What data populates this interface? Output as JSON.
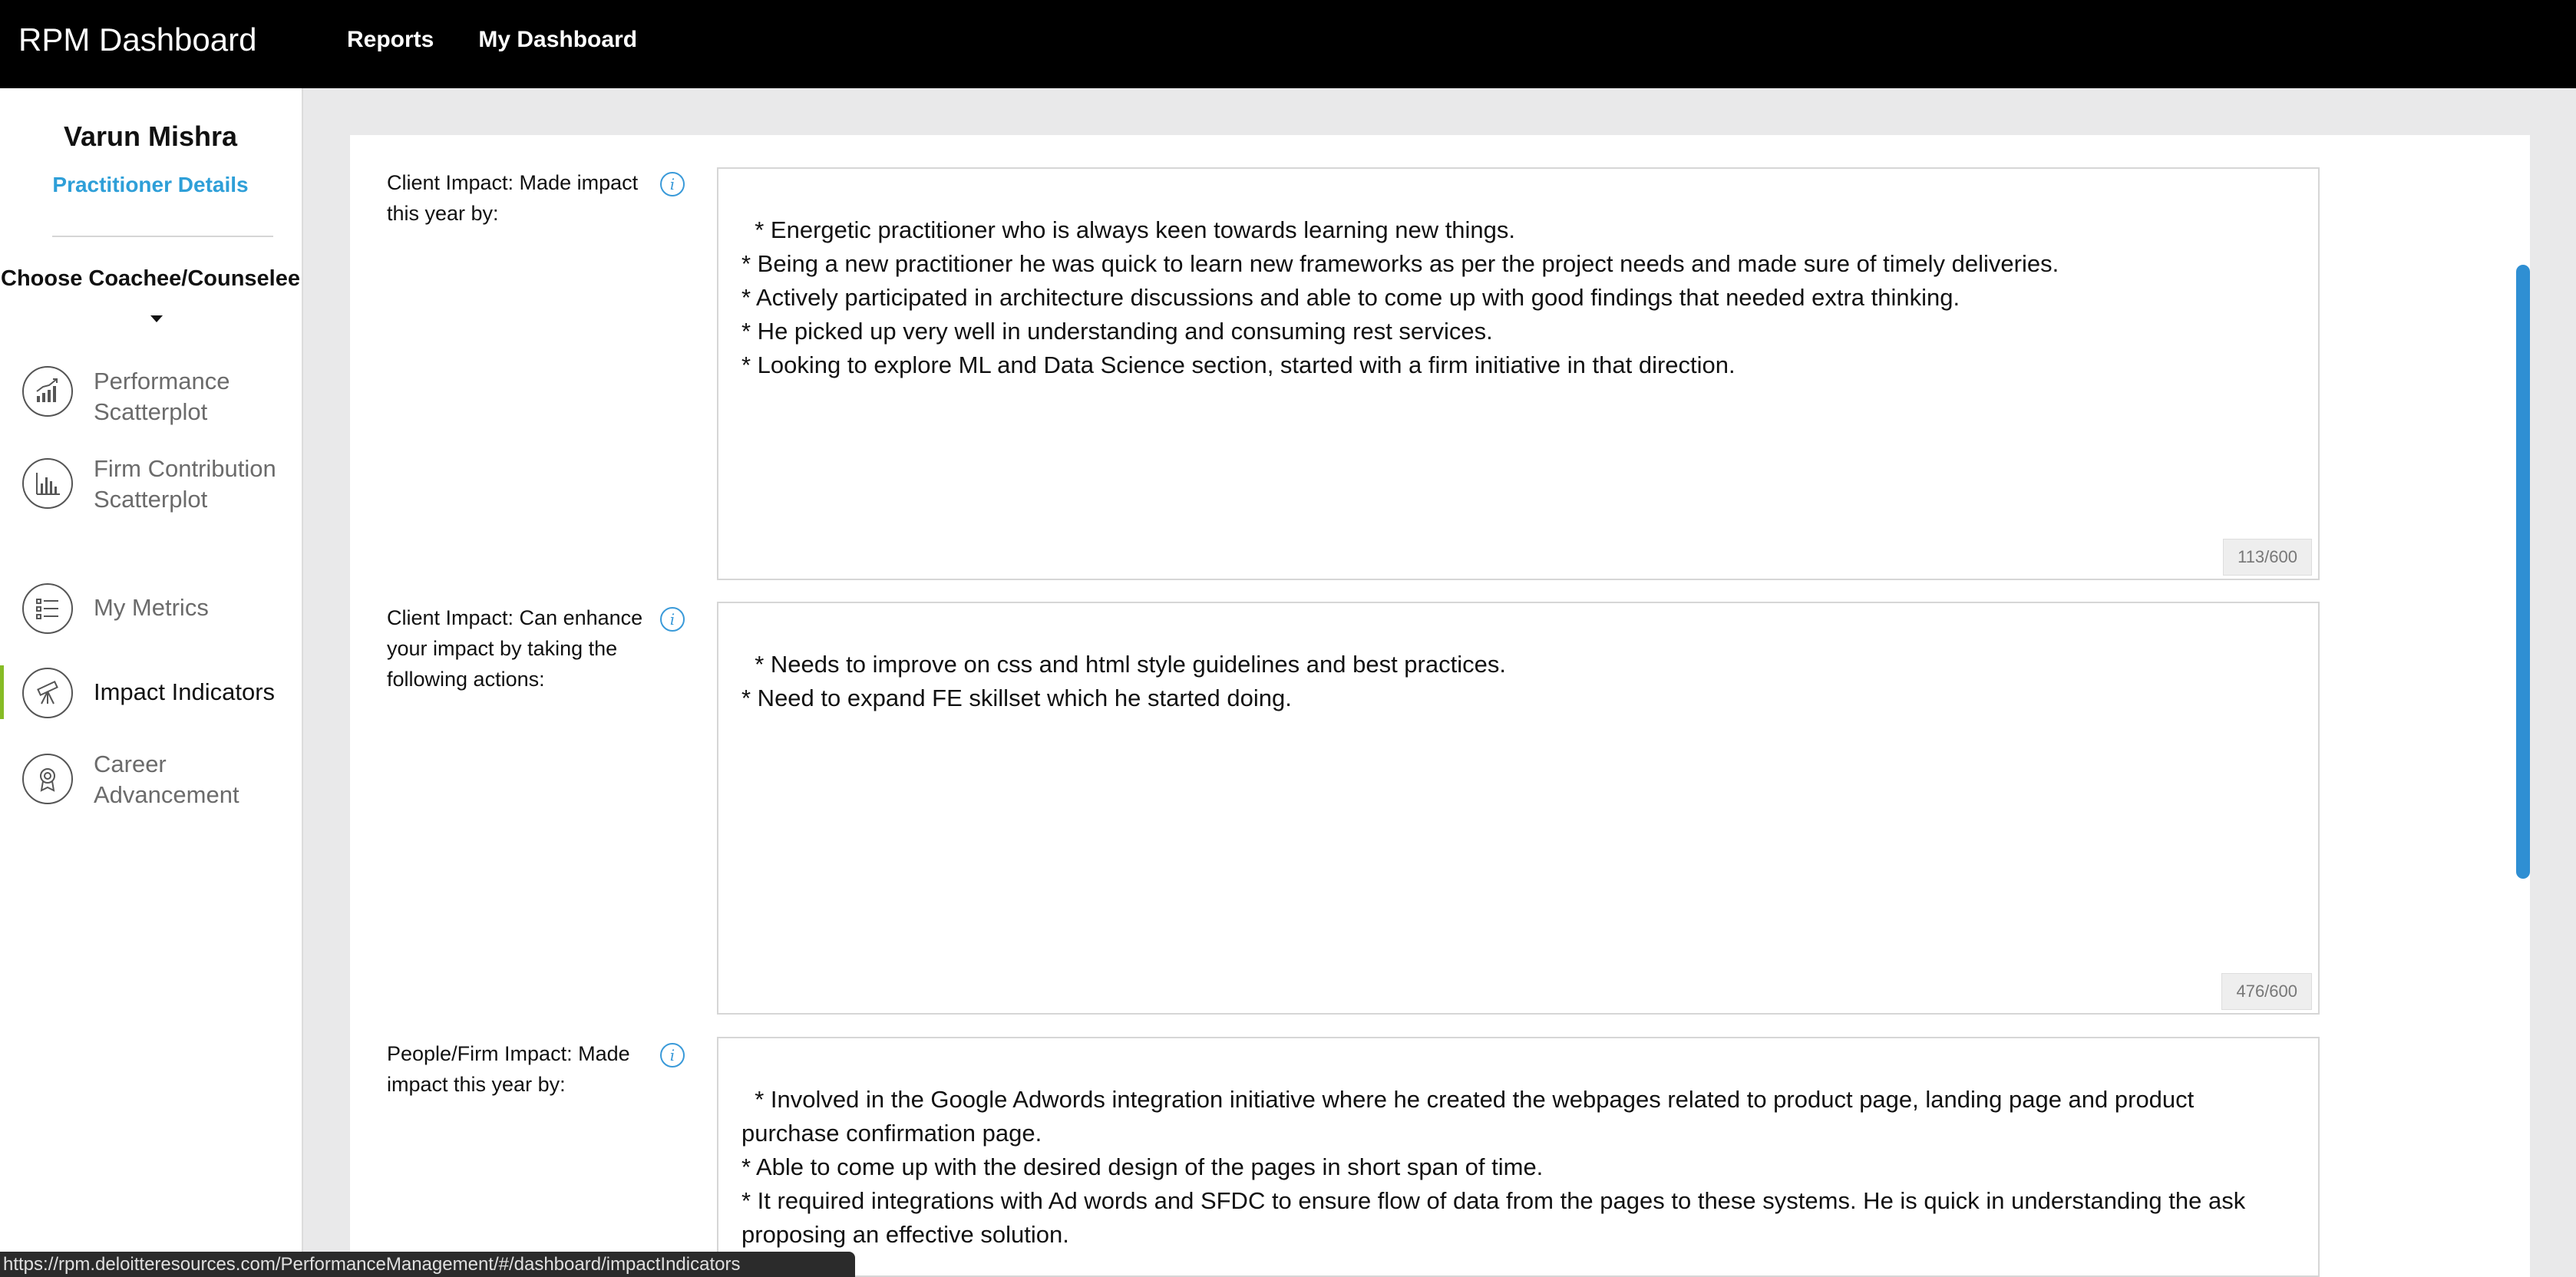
{
  "header": {
    "brand": "RPM Dashboard",
    "nav": [
      {
        "label": "Reports"
      },
      {
        "label": "My Dashboard"
      }
    ]
  },
  "sidebar": {
    "user_name": "Varun Mishra",
    "details_link": "Practitioner Details",
    "coachee_label": "Choose Coachee/Counselee",
    "items": [
      {
        "label": "Performance Scatterplot",
        "icon": "growth-chart-icon"
      },
      {
        "label": "Firm Contribution Scatterplot",
        "icon": "bar-chart-icon"
      },
      {
        "label": "My Metrics",
        "icon": "list-icon"
      },
      {
        "label": "Impact Indicators",
        "icon": "telescope-icon",
        "active": true
      },
      {
        "label": "Career Advancement",
        "icon": "award-icon"
      }
    ]
  },
  "fields": [
    {
      "label": "Client Impact: Made impact this year by:",
      "value": "* Energetic practitioner who is always keen towards learning new things.\n* Being a new practitioner he was quick to learn new frameworks as per the project needs and made sure of timely deliveries.\n* Actively participated in architecture discussions and able to come up with good findings that needed extra thinking.\n* He picked up very well in understanding and consuming rest services.\n* Looking to explore ML and Data Science section, started with a firm initiative in that direction.",
      "counter": "113/600"
    },
    {
      "label": "Client Impact: Can enhance your impact by taking the following actions:",
      "value": "* Needs to improve on css and html style guidelines and best practices.\n* Need to expand FE skillset which he started doing.",
      "counter": "476/600"
    },
    {
      "label": "People/Firm Impact: Made impact this year by:",
      "value": "* Involved in the Google Adwords integration initiative where he created the webpages related to product page, landing page and product purchase confirmation page.\n* Able to come up with the desired design of the pages in short span of time.\n* It required integrations with Ad words and SFDC to ensure flow of data from the pages to these systems. He is quick in understanding the ask proposing an effective solution.",
      "counter": ""
    }
  ],
  "status_url": "https://rpm.deloitteresources.com/PerformanceManagement/#/dashboard/impactIndicators",
  "colors": {
    "topbar": "#000000",
    "link_blue": "#2e9fd8",
    "active_green": "#86bc25",
    "scrollbar": "#2f8fd3"
  }
}
